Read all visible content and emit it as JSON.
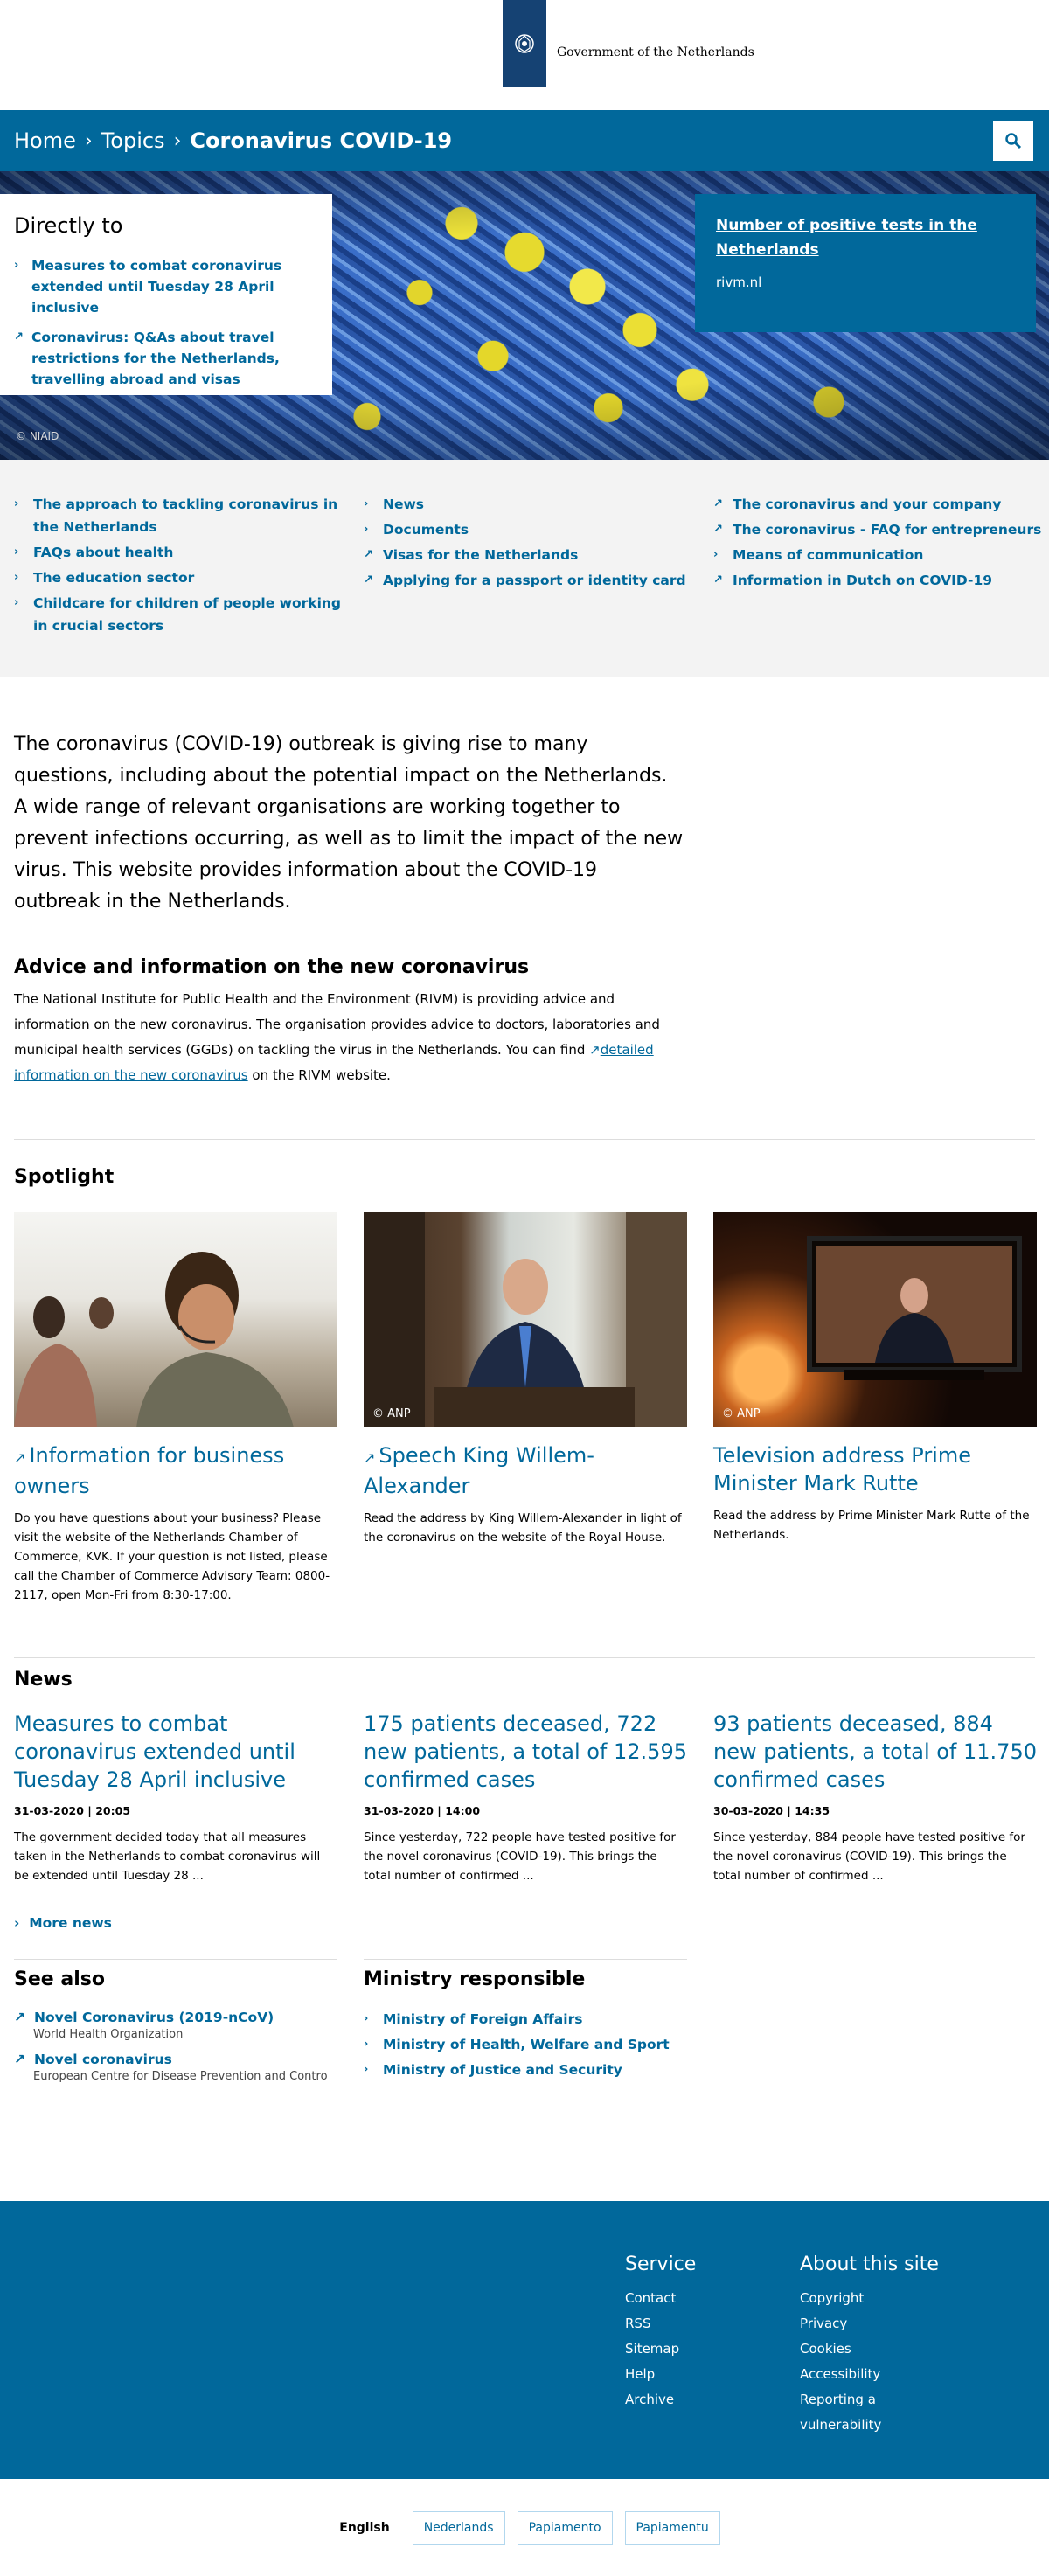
{
  "header": {
    "logo_text": "Government of the Netherlands"
  },
  "breadcrumb": {
    "home": "Home",
    "topics": "Topics",
    "current": "Coronavirus COVID-19"
  },
  "hero": {
    "directly_title": "Directly to",
    "directly_links": [
      {
        "label": "Measures to combat coronavirus extended until Tuesday 28 April inclusive"
      },
      {
        "label": "Coronavirus: Q&As about travel restrictions for the Netherlands, travelling abroad and visas"
      }
    ],
    "credit": "© NIAID",
    "rivm_title": "Number of positive tests in the Netherlands",
    "rivm_source": "rivm.nl"
  },
  "topics": {
    "col1": [
      "The approach to tackling coronavirus in the Netherlands",
      "FAQs about health",
      "The education sector",
      "Childcare for children of people working in crucial sectors"
    ],
    "col2": [
      "News",
      "Documents",
      "Visas for the Netherlands",
      "Applying for a passport or identity card"
    ],
    "col3": [
      "The coronavirus and your company",
      "The coronavirus - FAQ for entrepreneurs",
      "Means of communication",
      "Information in Dutch on COVID-19"
    ]
  },
  "intro": "The coronavirus (COVID-19) outbreak is giving rise to many questions, including about the potential impact on the Netherlands. A wide range of relevant organisations are working together to prevent infections occurring, as well as to limit the impact of the new virus. This website provides information about the COVID-19 outbreak in the Netherlands.",
  "advice": {
    "title": "Advice and information on the new coronavirus",
    "text_before": "The National Institute for Public Health and the Environment (RIVM) is providing advice and information on the new coronavirus. The organisation provides advice to doctors, laboratories and municipal health services (GGDs) on tackling the virus in the Netherlands. You can find ",
    "link": "detailed information on the new coronavirus",
    "text_after": " on the RIVM website."
  },
  "spotlight": {
    "title": "Spotlight",
    "cards": [
      {
        "title": "Information for business owners",
        "credit": "",
        "text": "Do you have questions about your business? Please visit the website of the Netherlands Chamber of Commerce, KVK. If your question is not listed, please call the Chamber of Commerce Advisory Team: 0800-2117, open Mon-Fri from 8:30-17:00."
      },
      {
        "title": "Speech King Willem-Alexander",
        "credit": "© ANP",
        "text": "Read the address by King Willem-Alexander in light of the coronavirus on the website of the Royal House."
      },
      {
        "title": "Television address Prime Minister Mark Rutte",
        "credit": "© ANP",
        "text": "Read the address by Prime Minister Mark Rutte of the Netherlands."
      }
    ]
  },
  "news": {
    "title": "News",
    "items": [
      {
        "title": "Measures to combat coronavirus extended until Tuesday 28 April inclusive",
        "date": "31-03-2020 | 20:05",
        "text": "The government decided today that all measures taken in the Netherlands to combat coronavirus will be extended until Tuesday 28 ..."
      },
      {
        "title": "175 patients deceased, 722 new patients, a total of 12.595 confirmed cases",
        "date": "31-03-2020 | 14:00",
        "text": "Since yesterday, 722 people have tested positive for the novel coronavirus (COVID-19). This brings the total number of confirmed ..."
      },
      {
        "title": "93 patients deceased, 884 new patients, a total of 11.750 confirmed cases",
        "date": "30-03-2020 | 14:35",
        "text": "Since yesterday, 884 people have tested positive for the novel coronavirus (COVID-19). This brings the total number of confirmed ..."
      }
    ],
    "more": "More news"
  },
  "see_also": {
    "title": "See also",
    "items": [
      {
        "label": "Novel Coronavirus (2019-nCoV)",
        "sub": "World Health Organization"
      },
      {
        "label": "Novel coronavirus",
        "sub": "European Centre for Disease Prevention and Contro"
      }
    ]
  },
  "ministry": {
    "title": "Ministry responsible",
    "items": [
      "Ministry of Foreign Affairs",
      "Ministry of Health, Welfare and Sport",
      "Ministry of Justice and Security"
    ]
  },
  "footer": {
    "service_title": "Service",
    "service_links": [
      "Contact",
      "RSS",
      "Sitemap",
      "Help",
      "Archive"
    ],
    "about_title": "About this site",
    "about_links": [
      "Copyright",
      "Privacy",
      "Cookies",
      "Accessibility",
      "Reporting a",
      "vulnerability"
    ]
  },
  "languages": [
    "English",
    "Nederlands",
    "Papiamento",
    "Papiamentu"
  ],
  "colors": {
    "brand_blue": "#01689b",
    "logo_blue": "#154273"
  }
}
